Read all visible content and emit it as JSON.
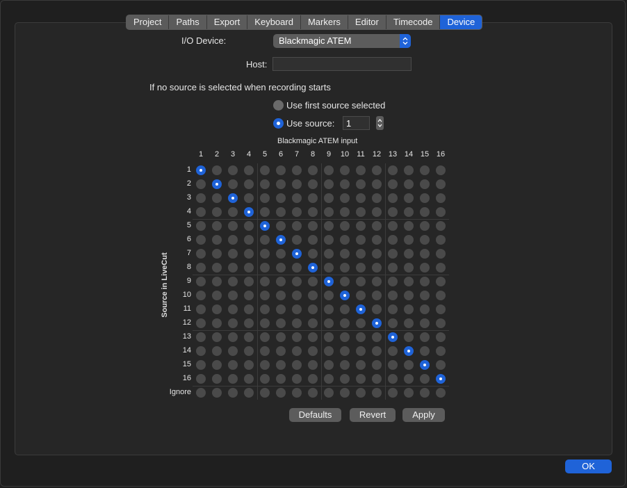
{
  "tabs": [
    {
      "label": "Project",
      "active": false
    },
    {
      "label": "Paths",
      "active": false
    },
    {
      "label": "Export",
      "active": false
    },
    {
      "label": "Keyboard",
      "active": false
    },
    {
      "label": "Markers",
      "active": false
    },
    {
      "label": "Editor",
      "active": false
    },
    {
      "label": "Timecode",
      "active": false
    },
    {
      "label": "Device",
      "active": true
    }
  ],
  "io_device": {
    "label": "I/O Device:",
    "value": "Blackmagic ATEM"
  },
  "host": {
    "label": "Host:",
    "value": ""
  },
  "no_source": {
    "prompt": "If no source is selected when recording starts",
    "option_first": "Use first source selected",
    "option_use": "Use source:",
    "selected": "use_source",
    "source_value": "1"
  },
  "matrix": {
    "title": "Blackmagic ATEM input",
    "row_axis_label": "Source in LiveCut",
    "columns": [
      "1",
      "2",
      "3",
      "4",
      "5",
      "6",
      "7",
      "8",
      "9",
      "10",
      "11",
      "12",
      "13",
      "14",
      "15",
      "16"
    ],
    "rows": [
      "1",
      "2",
      "3",
      "4",
      "5",
      "6",
      "7",
      "8",
      "9",
      "10",
      "11",
      "12",
      "13",
      "14",
      "15",
      "16",
      "Ignore"
    ],
    "selected_column_per_row": [
      1,
      2,
      3,
      4,
      5,
      6,
      7,
      8,
      9,
      10,
      11,
      12,
      13,
      14,
      15,
      16,
      null
    ]
  },
  "buttons": {
    "defaults": "Defaults",
    "revert": "Revert",
    "apply": "Apply",
    "ok": "OK"
  },
  "colors": {
    "accent": "#1f63d8",
    "cell_off": "#4a4a4a"
  }
}
